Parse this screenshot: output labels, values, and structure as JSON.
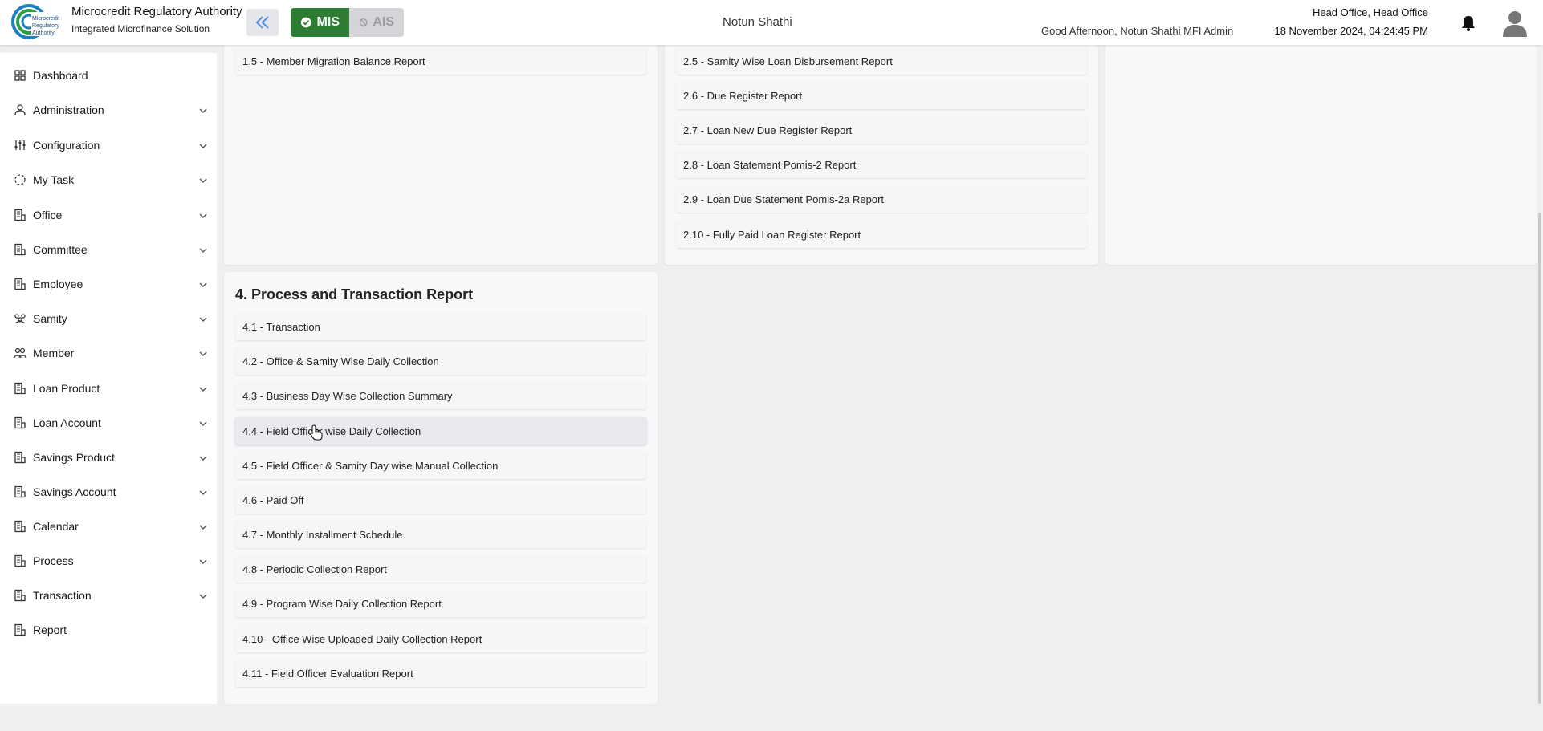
{
  "header": {
    "org_title": "Microcredit Regulatory Authority",
    "org_subtitle": "Integrated Microfinance Solution",
    "logo_text": "Microcredit Regulatory Authority",
    "mode_active": "MIS",
    "mode_inactive": "AIS",
    "center_name": "Notun Shathi",
    "greeting": "Good Afternoon, Notun Shathi MFI Admin",
    "office": "Head Office, Head Office",
    "datetime": "18 November 2024, 04:24:45 PM",
    "icons": {
      "collapse": "double-chevron-left-icon",
      "bell": "bell-icon",
      "avatar": "user-avatar-icon"
    },
    "colors": {
      "accent": "#2e7d32",
      "inactive": "#d3d5d9"
    }
  },
  "sidebar": {
    "items": [
      {
        "label": "Dashboard",
        "icon": "grid-icon",
        "expandable": false
      },
      {
        "label": "Administration",
        "icon": "admin-icon",
        "expandable": true
      },
      {
        "label": "Configuration",
        "icon": "sliders-icon",
        "expandable": true
      },
      {
        "label": "My Task",
        "icon": "task-icon",
        "expandable": true
      },
      {
        "label": "Office",
        "icon": "office-icon",
        "expandable": true
      },
      {
        "label": "Committee",
        "icon": "committee-icon",
        "expandable": true
      },
      {
        "label": "Employee",
        "icon": "employee-icon",
        "expandable": true
      },
      {
        "label": "Samity",
        "icon": "samity-icon",
        "expandable": true
      },
      {
        "label": "Member",
        "icon": "member-icon",
        "expandable": true
      },
      {
        "label": "Loan Product",
        "icon": "loan-product-icon",
        "expandable": true
      },
      {
        "label": "Loan Account",
        "icon": "loan-account-icon",
        "expandable": true
      },
      {
        "label": "Savings Product",
        "icon": "savings-product-icon",
        "expandable": true
      },
      {
        "label": "Savings Account",
        "icon": "savings-account-icon",
        "expandable": true
      },
      {
        "label": "Calendar",
        "icon": "calendar-icon",
        "expandable": true
      },
      {
        "label": "Process",
        "icon": "process-icon",
        "expandable": true
      },
      {
        "label": "Transaction",
        "icon": "transaction-icon",
        "expandable": true
      },
      {
        "label": "Report",
        "icon": "report-icon",
        "expandable": false
      }
    ]
  },
  "reports": {
    "col1_top": [
      "1.5 - Member Migration Balance Report"
    ],
    "col2_top": [
      "2.5 - Samity Wise Loan Disbursement Report",
      "2.6 - Due Register Report",
      "2.7 - Loan New Due Register Report",
      "2.8 - Loan Statement Pomis-2 Report",
      "2.9 - Loan Due Statement Pomis-2a Report",
      "2.10 - Fully Paid Loan Register Report"
    ],
    "section4_title": "4. Process and Transaction Report",
    "section4_items": [
      "4.1 - Transaction",
      "4.2 - Office & Samity Wise Daily Collection",
      "4.3 - Business Day Wise Collection Summary",
      "4.4 - Field Officer wise Daily Collection",
      "4.5 - Field Officer & Samity Day wise Manual Collection",
      "4.6 - Paid Off",
      "4.7 - Monthly Installment Schedule",
      "4.8 - Periodic Collection Report",
      "4.9 - Program Wise Daily Collection Report",
      "4.10 - Office Wise Uploaded Daily Collection Report",
      "4.11 - Field Officer Evaluation Report"
    ]
  }
}
